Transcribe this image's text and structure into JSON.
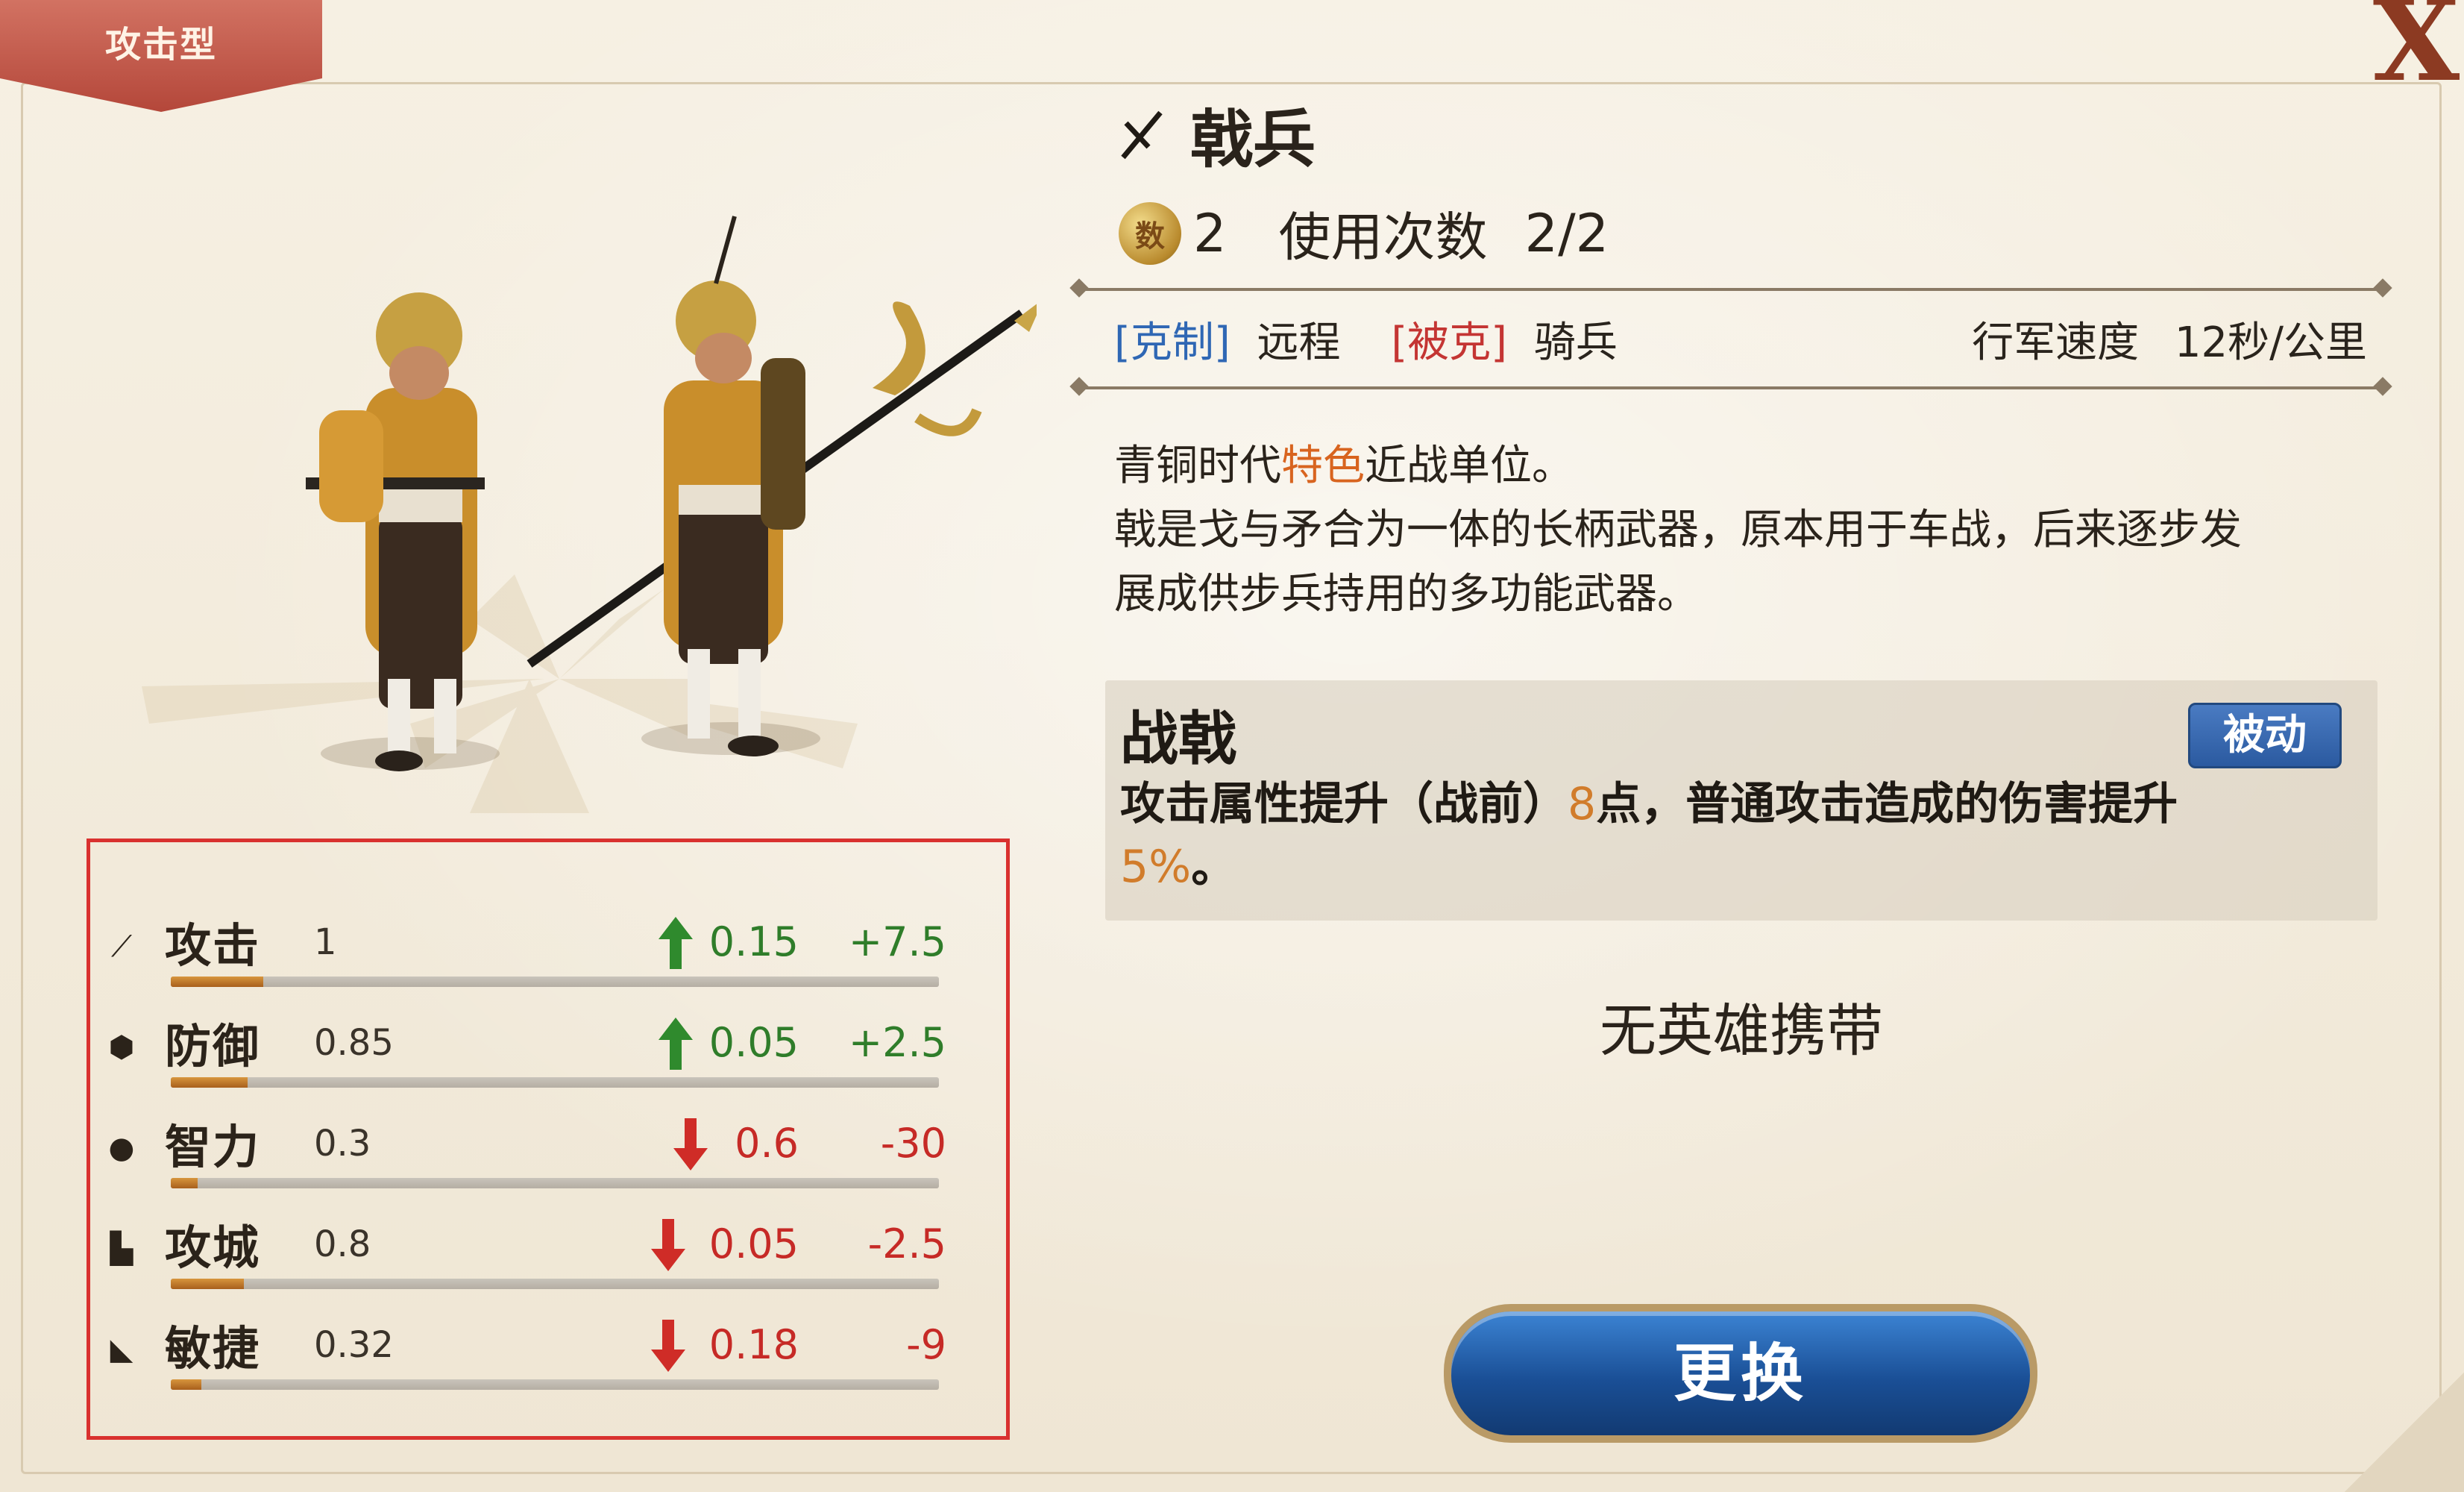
{
  "type_tag": "攻击型",
  "close_label": "X",
  "unit": {
    "name": "戟兵",
    "cost": "2",
    "usage_label": "使用次数",
    "usage_value": "2/2"
  },
  "counters": {
    "counter_tag": "[克制]",
    "counter_target": "远程",
    "countered_tag": "[被克]",
    "countered_by": "骑兵",
    "speed_label": "行军速度",
    "speed_value": "12秒/公里"
  },
  "description": {
    "line1_before": "青铜时代",
    "line1_highlight": "特色",
    "line1_after": "近战单位。",
    "line2": "戟是戈与矛合为一体的长柄武器，原本用于车战，后来逐步发",
    "line3": "展成供步兵持用的多功能武器。"
  },
  "skill": {
    "name": "战戟",
    "badge": "被动",
    "desc_part1": "攻击属性提升（战前）",
    "desc_num1": "8",
    "desc_part2": "点，普通攻击造成的伤害提升",
    "desc_num2": "5%",
    "desc_part3": "。"
  },
  "no_hero_text": "无英雄携带",
  "replace_button": "更换",
  "stats": [
    {
      "icon": "sword-icon",
      "name": "攻击",
      "base": "1",
      "direction": "up",
      "delta": "0.15",
      "total": "+7.5",
      "level": 0.12
    },
    {
      "icon": "shield-icon",
      "name": "防御",
      "base": "0.85",
      "direction": "up",
      "delta": "0.05",
      "total": "+2.5",
      "level": 0.1
    },
    {
      "icon": "brain-icon",
      "name": "智力",
      "base": "0.3",
      "direction": "down",
      "delta": "0.6",
      "total": "-30",
      "level": 0.035
    },
    {
      "icon": "tower-icon",
      "name": "攻城",
      "base": "0.8",
      "direction": "down",
      "delta": "0.05",
      "total": "-2.5",
      "level": 0.095
    },
    {
      "icon": "boot-icon",
      "name": "敏捷",
      "base": "0.32",
      "direction": "down",
      "delta": "0.18",
      "total": "-9",
      "level": 0.04
    }
  ]
}
